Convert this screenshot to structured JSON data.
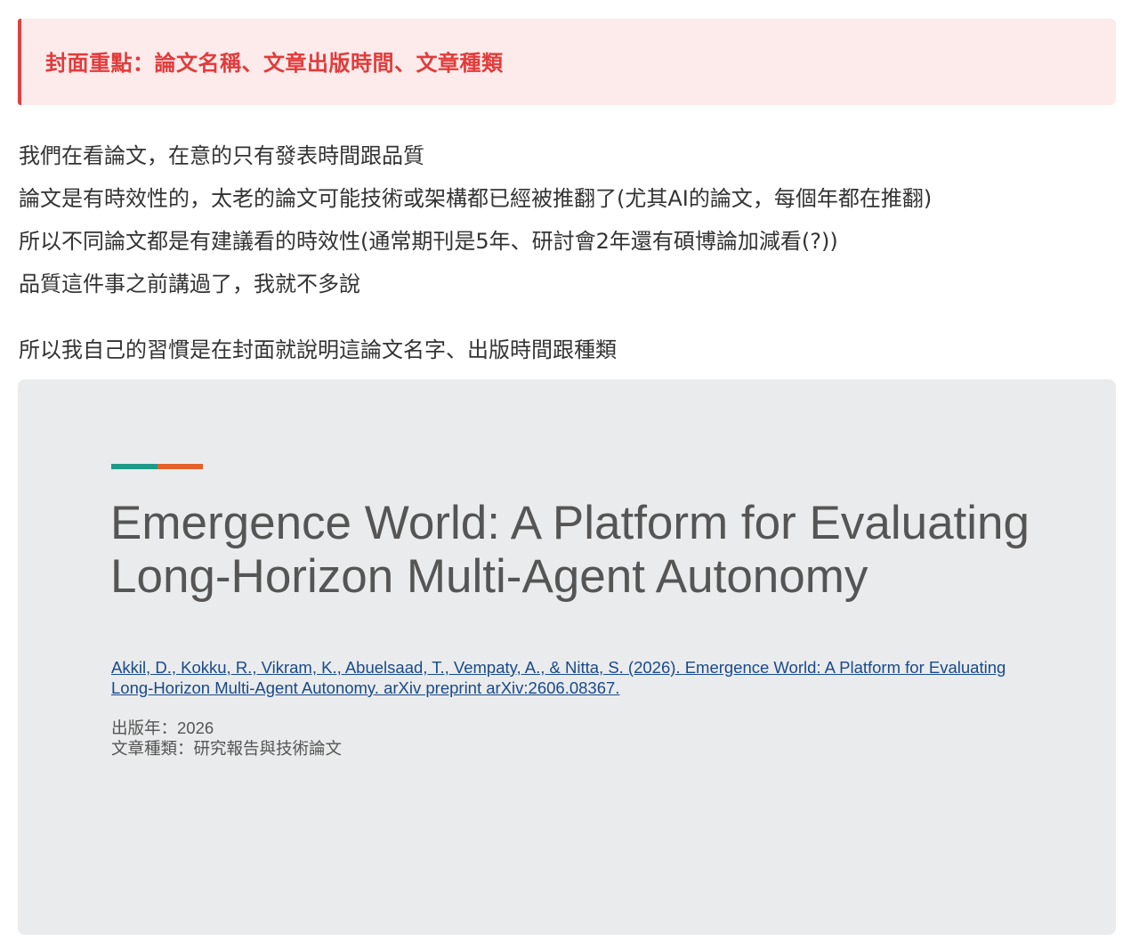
{
  "callout": {
    "text": "封面重點：論文名稱、文章出版時間、文章種類",
    "accent_color": "#e04040",
    "background_color": "#fdeaea"
  },
  "paragraphs": [
    "我們在看論文，在意的只有發表時間跟品質",
    "論文是有時效性的，太老的論文可能技術或架構都已經被推翻了(尤其AI的論文，每個年都在推翻)",
    "所以不同論文都是有建議看的時效性(通常期刊是5年、研討會2年還有碩博論加減看(?))",
    "品質這件事之前講過了，我就不多說"
  ],
  "closing_paragraph": "所以我自己的習慣是在封面就說明這論文名字、出版時間跟種類",
  "slide": {
    "background_color": "#e9ebec",
    "accent_colors": [
      "#1f9a8a",
      "#e2622a"
    ],
    "title_line_1": "Emergence World: A Platform for Evaluating",
    "title_line_2": "Long-Horizon Multi-Agent Autonomy",
    "citation": "Akkil, D., Kokku, R., Vikram, K., Abuelsaad, T., Vempaty, A., & Nitta, S. (2026). Emergence World: A Platform for Evaluating Long-Horizon Multi-Agent Autonomy. arXiv preprint arXiv:2606.08367.",
    "publish_year": "出版年：2026",
    "article_type": "文章種類：研究報告與技術論文"
  }
}
